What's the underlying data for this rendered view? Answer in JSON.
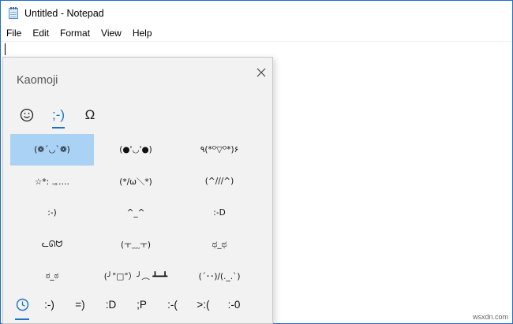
{
  "window": {
    "title": "Untitled - Notepad"
  },
  "menu": {
    "items": [
      "File",
      "Edit",
      "Format",
      "View",
      "Help"
    ]
  },
  "editor": {
    "content": ""
  },
  "panel": {
    "title": "Kaomoji",
    "tabs": [
      {
        "name": "emoji",
        "icon": "smiley-icon"
      },
      {
        "name": "kaomoji",
        "label": ";-)"
      },
      {
        "name": "symbols",
        "label": "Ω"
      }
    ],
    "kaomoji": [
      "(❁´◡`❁)",
      "(●'◡'●)",
      "٩(*ᴼ▽ᴼ*)۶",
      "☆*: .｡.…",
      "(*/ω＼*)",
      "(^///^)",
      ":-)",
      "^_^",
      ":-D",
      "ᓚᘏᗢ",
      "(ㅜ﹏ㅜ)",
      "ಥ_ಥ",
      "ಠ_ಠ",
      "(╯°□°）╯︵ ┻━┻",
      "(´･･)/(._.`)"
    ],
    "recents": [
      ":-)",
      "=)",
      ":D",
      ";P",
      ":-(",
      ">:(",
      ":-0"
    ],
    "accent_color": "#1a73c7",
    "selected_color": "#a9d2f5"
  },
  "watermark": "wsxdn.com"
}
